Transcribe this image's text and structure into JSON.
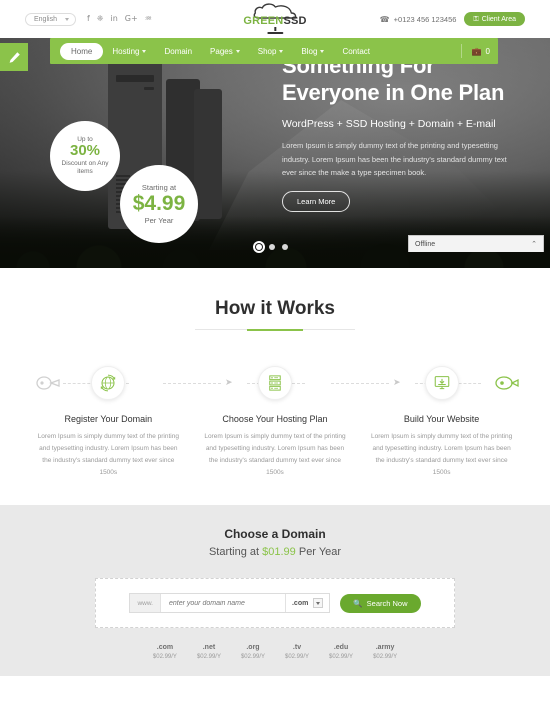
{
  "topbar": {
    "language": "English",
    "social": [
      {
        "name": "facebook-icon",
        "glyph": "f"
      },
      {
        "name": "twitter-icon",
        "glyph": "❈"
      },
      {
        "name": "linkedin-icon",
        "glyph": "in"
      },
      {
        "name": "googleplus-icon",
        "glyph": "G+"
      },
      {
        "name": "rss-icon",
        "glyph": "♒"
      }
    ],
    "phone": "+0123 456 123456",
    "client_area": "Client Area",
    "headset_icon": "☎",
    "lock_icon": "⚿"
  },
  "logo": {
    "green": "GREEN",
    "dark": "SSD"
  },
  "nav": {
    "items": [
      {
        "label": "Home",
        "dropdown": false,
        "active": true
      },
      {
        "label": "Hosting",
        "dropdown": true,
        "active": false
      },
      {
        "label": "Domain",
        "dropdown": false,
        "active": false
      },
      {
        "label": "Pages",
        "dropdown": true,
        "active": false
      },
      {
        "label": "Shop",
        "dropdown": true,
        "active": false
      },
      {
        "label": "Blog",
        "dropdown": true,
        "active": false
      },
      {
        "label": "Contact",
        "dropdown": false,
        "active": false
      }
    ],
    "cart_icon": "💼",
    "cart_count": "0"
  },
  "hero": {
    "title_line1": "Something For",
    "title_line2": "Everyone in One Plan",
    "subtitle": "WordPress + SSD Hosting + Domain + E-mail",
    "paragraph": "Lorem Ipsum is simply dummy text of the printing and typesetting industry. Lorem Ipsum has been the industry's standard dummy text ever since the make a type specimen book.",
    "cta": "Learn More",
    "discount_badge": {
      "top": "Up to",
      "value": "30%",
      "bottom": "Discount on Any items"
    },
    "price_badge": {
      "top": "Starting at",
      "value": "$4.99",
      "bottom": "Per Year"
    },
    "slides": 3,
    "active_slide": 1,
    "chat_status": "Offline",
    "chat_chevron": "⌃"
  },
  "works": {
    "title": "How it Works",
    "steps": [
      {
        "title": "Register Your Domain",
        "text": "Lorem Ipsum is simply dummy text of the printing and typesetting industry. Lorem Ipsum has been the industry's standard dummy text ever since 1500s",
        "icon": "globe-refresh-icon"
      },
      {
        "title": "Choose Your Hosting Plan",
        "text": "Lorem Ipsum is simply dummy text of the printing and typesetting industry. Lorem Ipsum has been the industry's standard dummy text ever since 1500s",
        "icon": "server-rack-icon"
      },
      {
        "title": "Build Your Website",
        "text": "Lorem Ipsum is simply dummy text of the printing and typesetting industry. Lorem Ipsum has been the industry's standard dummy text ever since 1500s",
        "icon": "monitor-download-icon"
      }
    ],
    "arrow": "➤"
  },
  "domain": {
    "title": "Choose a Domain",
    "subtitle_prefix": "Starting at ",
    "subtitle_price": "$01.99",
    "subtitle_suffix": " Per Year",
    "www_label": "www.",
    "input_placeholder": "enter your domain name",
    "input_value": "",
    "tld_selected": ".com",
    "search_button": "Search Now",
    "search_icon": "🔍",
    "tld_list": [
      {
        "name": ".com",
        "price": "$02.99/Y"
      },
      {
        "name": ".net",
        "price": "$02.99/Y"
      },
      {
        "name": ".org",
        "price": "$02.99/Y"
      },
      {
        "name": ".tv",
        "price": "$02.99/Y"
      },
      {
        "name": ".edu",
        "price": "$02.99/Y"
      },
      {
        "name": ".army",
        "price": "$02.99/Y"
      }
    ]
  },
  "colors": {
    "brand_green": "#8bc34a",
    "dark_green": "#6aa92e",
    "text_dark": "#2f2f2f"
  }
}
